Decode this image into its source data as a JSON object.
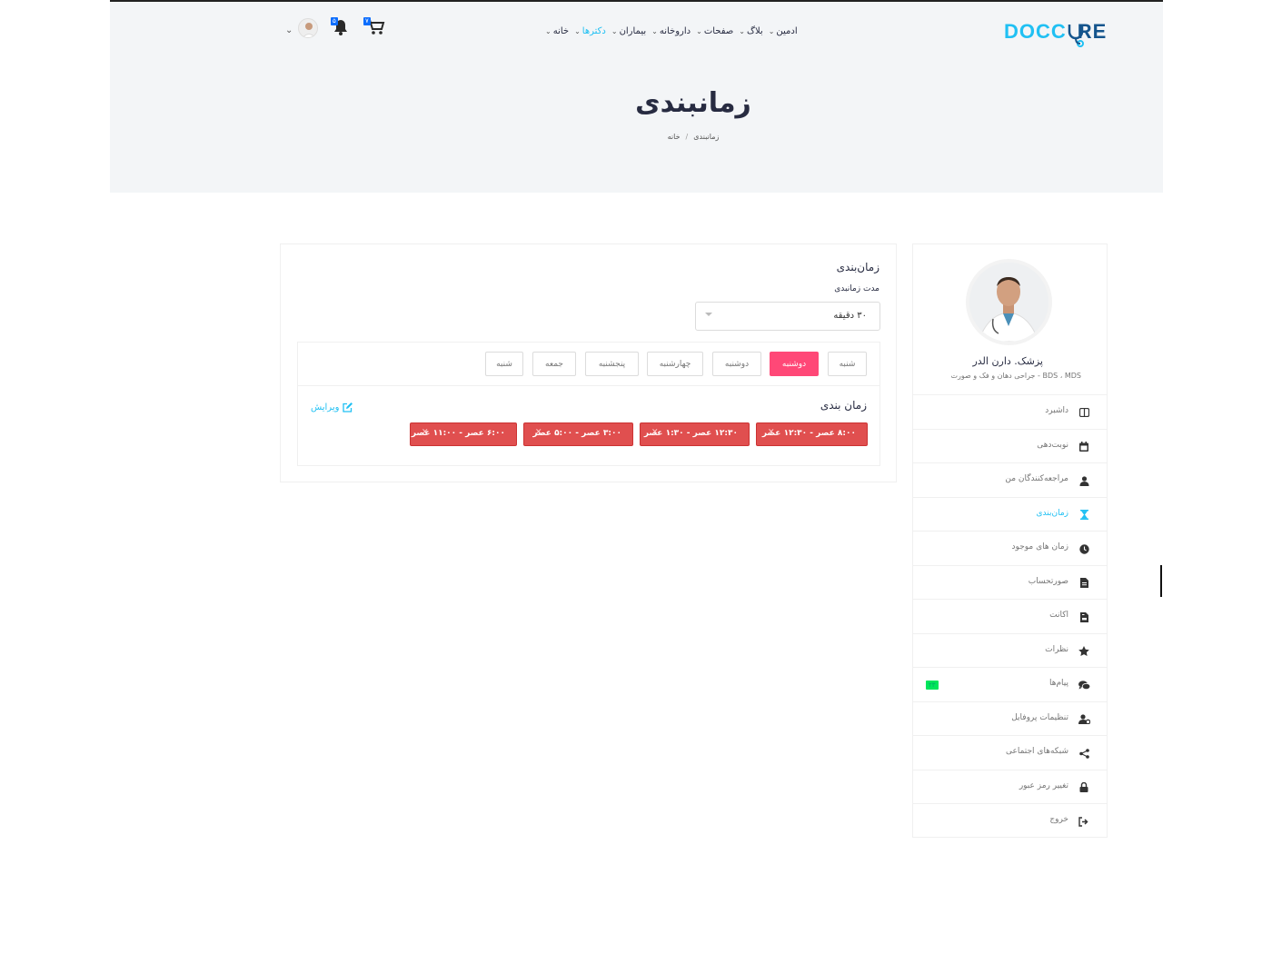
{
  "brand": {
    "part1": "DOCC",
    "part2": "RE",
    "colors": {
      "primary": "#20c0f3",
      "dark": "#15558d"
    }
  },
  "nav": [
    {
      "label": "خانه",
      "active": false
    },
    {
      "label": "دکترها",
      "active": true
    },
    {
      "label": "بیماران",
      "active": false
    },
    {
      "label": "داروخانه",
      "active": false
    },
    {
      "label": "صفحات",
      "active": false
    },
    {
      "label": "بلاگ",
      "active": false
    },
    {
      "label": "ادمین",
      "active": false
    }
  ],
  "header": {
    "cart_badge": "۷",
    "bell_badge": "۵"
  },
  "page": {
    "title": "زمانبندی",
    "breadcrumb": [
      "خانه",
      "زمانبندی"
    ]
  },
  "doctor": {
    "name": "پزشک. دارن الدر",
    "specialty": "BDS ، MDS - جراحی دهان و فک و صورت"
  },
  "sidebar": {
    "items": [
      {
        "label": "داشبرد",
        "icon": "dashboard-icon"
      },
      {
        "label": "نوبت‌دهی",
        "icon": "calendar-icon"
      },
      {
        "label": "مراجعه‌کنندگان من",
        "icon": "user-injured-icon"
      },
      {
        "label": "زمان‌بندی",
        "icon": "hourglass-icon"
      },
      {
        "label": "زمان های موجود",
        "icon": "clock-icon"
      },
      {
        "label": "صورتحساب",
        "icon": "invoice-icon"
      },
      {
        "label": "اکانت",
        "icon": "file-invoice-icon"
      },
      {
        "label": "نظرات",
        "icon": "star-icon"
      },
      {
        "label": "پیام‌ها",
        "icon": "comments-icon",
        "badge": "۲۳"
      },
      {
        "label": "تنظیمات پروفایل",
        "icon": "user-cog-icon"
      },
      {
        "label": "شبکه‌های اجتماعی",
        "icon": "share-icon"
      },
      {
        "label": "تغییر رمز عبور",
        "icon": "lock-icon"
      },
      {
        "label": "خروج",
        "icon": "sign-out-icon"
      }
    ],
    "active_index": 3
  },
  "schedule": {
    "card_title": "زمان‌بندی",
    "duration_label": "مدت زمانبدی",
    "duration_value": "۳۰ دقیقه",
    "days": [
      "شنبه",
      "دوشنبه",
      "دوشنبه",
      "چهارشنبه",
      "پنجشنبه",
      "جمعه",
      "شنبه"
    ],
    "active_day_index": 1,
    "section_title": "زمان بندی",
    "edit_label": "ویرایش",
    "slots": [
      "۸:۰۰ عصر - ۱۲:۳۰ عصر",
      "۱۲:۳۰ عصر - ۱:۳۰ عصر",
      "۳:۰۰ عصر - ۵:۰۰ عصر",
      "۶:۰۰ عصر - ۱۱:۰۰ عصر"
    ],
    "slot_color": "#e04f4f",
    "active_day_color": "#ff4877"
  }
}
